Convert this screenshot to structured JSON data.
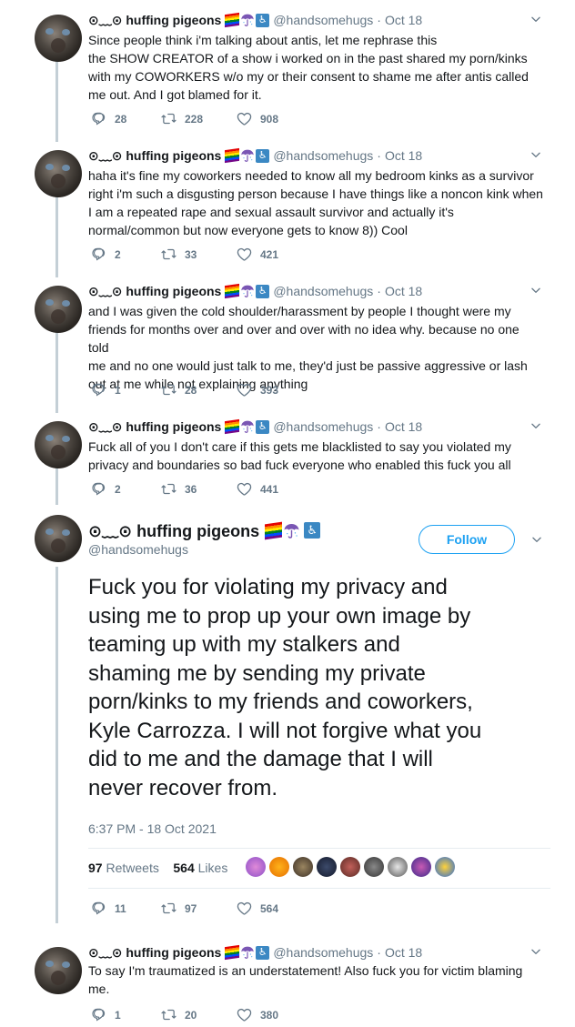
{
  "author": {
    "display_name": "⊙﹏⊙ huffing pigeons",
    "handle": "@handsomehugs"
  },
  "tweets": [
    {
      "date": "Oct 18",
      "lines": [
        "Since people think i'm talking about antis, let me rephrase this",
        "the SHOW CREATOR of a show i worked on in the past shared my porn/kinks",
        "with my COWORKERS w/o my or their consent to shame me after antis called",
        "me out. And I got blamed for it."
      ],
      "replies": "28",
      "retweets": "228",
      "likes": "908"
    },
    {
      "date": "Oct 18",
      "lines": [
        "haha it's fine my coworkers needed to know all my bedroom kinks as a survivor",
        "right i'm such a disgusting person because I have things like a noncon kink when",
        "I am a repeated rape and sexual assault survivor and actually it's",
        "normal/common but now everyone gets to know 8)) Cool"
      ],
      "replies": "2",
      "retweets": "33",
      "likes": "421"
    },
    {
      "date": "Oct 18",
      "lines": [
        "and I was given the cold shoulder/harassment by people I thought were my",
        "friends for months over and over and over with no idea why. because no one told",
        "me and no one would just talk to me, they'd just be passive aggressive or lash",
        "out at me while not explaining anything"
      ],
      "replies": "1",
      "retweets": "28",
      "likes": "393"
    },
    {
      "date": "Oct 18",
      "lines": [
        "Fuck all of you I don't care if this gets me blacklisted to say you violated my",
        "privacy and boundaries so bad fuck everyone who enabled this fuck you all"
      ],
      "replies": "2",
      "retweets": "36",
      "likes": "441"
    }
  ],
  "main_tweet": {
    "follow_label": "Follow",
    "lines": [
      "Fuck you for violating my privacy and",
      "using me to prop up your own image by",
      "teaming up with my stalkers and",
      "shaming me by sending my private",
      "porn/kinks to my friends and coworkers,",
      "Kyle Carrozza. I will not forgive what you",
      "did to me and the damage that I will",
      "never recover from."
    ],
    "timestamp": "6:37 PM - 18 Oct 2021",
    "retweets_count": "97",
    "retweets_label": "Retweets",
    "likes_count": "564",
    "likes_label": "Likes",
    "replies": "11",
    "retweets": "97",
    "likes": "564"
  },
  "reply_tweet": {
    "date": "Oct 18",
    "lines": [
      "To say I'm traumatized is an understatement! Also fuck you for victim blaming",
      "me."
    ],
    "replies": "1",
    "retweets": "20",
    "likes": "380"
  },
  "colors": {
    "accent": "#1da1f2",
    "secondary_text": "#657786",
    "thread_line": "#c4cfd6"
  },
  "icons": [
    "reply-icon",
    "retweet-icon",
    "like-icon",
    "chevron-down-icon",
    "rainbow-flag-icon",
    "umbrella-icon",
    "wheelchair-icon"
  ]
}
